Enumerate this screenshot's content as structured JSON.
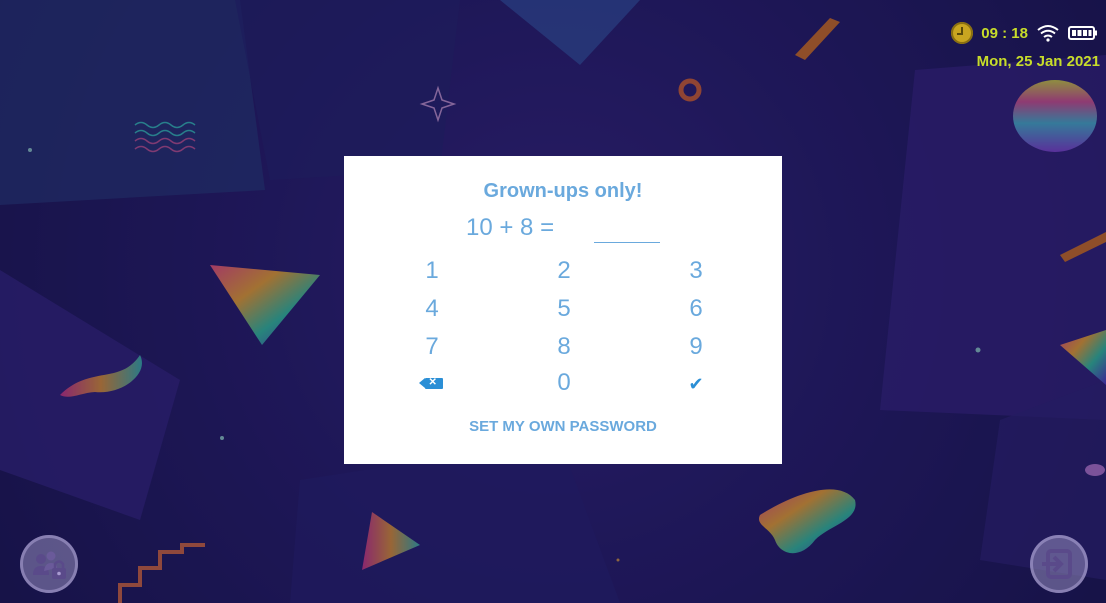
{
  "status_bar": {
    "time": "09 : 18",
    "date": "Mon, 25 Jan 2021",
    "icons": [
      "clock-icon",
      "wifi-icon",
      "battery-icon"
    ]
  },
  "dialog": {
    "title": "Grown-ups only!",
    "equation": "10 + 8 =",
    "answer": "",
    "keys": [
      "1",
      "2",
      "3",
      "4",
      "5",
      "6",
      "7",
      "8",
      "9",
      "0"
    ],
    "backspace_icon": "backspace-icon",
    "confirm_icon": "check-icon",
    "set_password_label": "SET MY OWN PASSWORD"
  },
  "bottom": {
    "left_button_icon": "parent-lock-icon",
    "right_button_icon": "exit-icon"
  },
  "colors": {
    "dialog_text": "#6aa9dd",
    "accent_blue": "#2b8fd6",
    "status_text": "#c8dd2a",
    "background": "#2b2176"
  }
}
